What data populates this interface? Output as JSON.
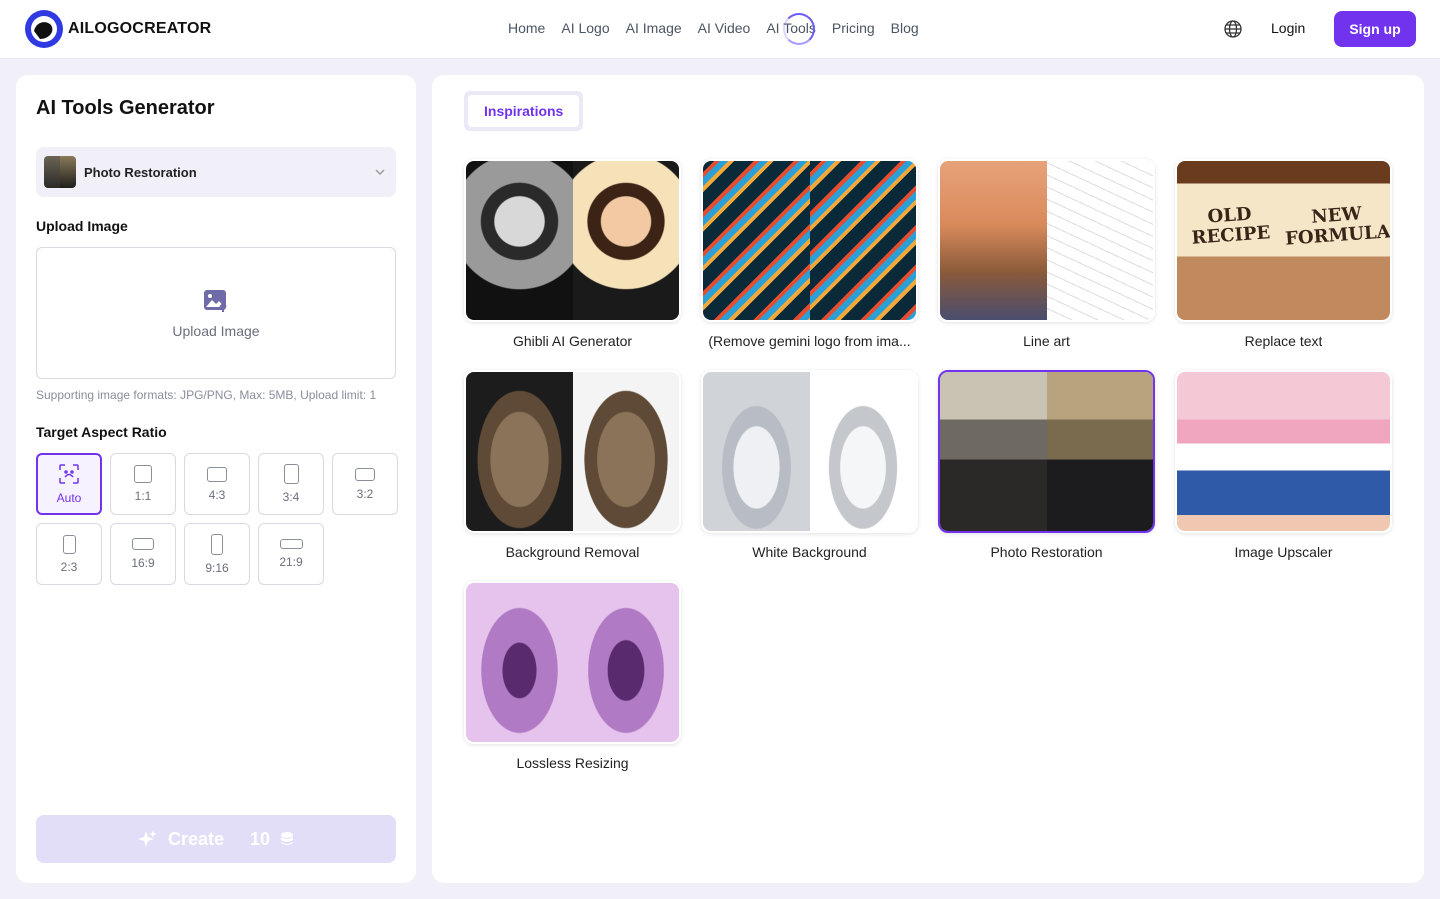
{
  "header": {
    "logo_text": "AILOGOCREATOR",
    "nav": [
      "Home",
      "AI Logo",
      "AI Image",
      "AI Video",
      "AI Tools",
      "Pricing",
      "Blog"
    ],
    "login": "Login",
    "signup": "Sign up"
  },
  "left": {
    "title": "AI Tools Generator",
    "selected_tool": "Photo Restoration",
    "upload_label": "Upload Image",
    "upload_button": "Upload Image",
    "formats_note": "Supporting image formats: JPG/PNG, Max: 5MB, Upload limit: 1",
    "aspect_label": "Target Aspect Ratio",
    "ratios": [
      "Auto",
      "1:1",
      "4:3",
      "3:4",
      "3:2",
      "2:3",
      "16:9",
      "9:16",
      "21:9"
    ],
    "selected_ratio": "Auto",
    "create_label": "Create",
    "create_cost": "10"
  },
  "right": {
    "tab": "Inspirations",
    "cards": [
      {
        "caption": "Ghibli AI Generator"
      },
      {
        "caption": "(Remove gemini logo from ima..."
      },
      {
        "caption": "Line art"
      },
      {
        "caption": "Replace text",
        "left_text": "OLD RECIPE",
        "right_text": "NEW FORMULA"
      },
      {
        "caption": "Background Removal"
      },
      {
        "caption": "White Background"
      },
      {
        "caption": "Photo Restoration",
        "selected": true
      },
      {
        "caption": "Image Upscaler"
      },
      {
        "caption": "Lossless Resizing"
      }
    ]
  },
  "colors": {
    "accent": "#7133ee",
    "background": "#f1f0f8"
  }
}
